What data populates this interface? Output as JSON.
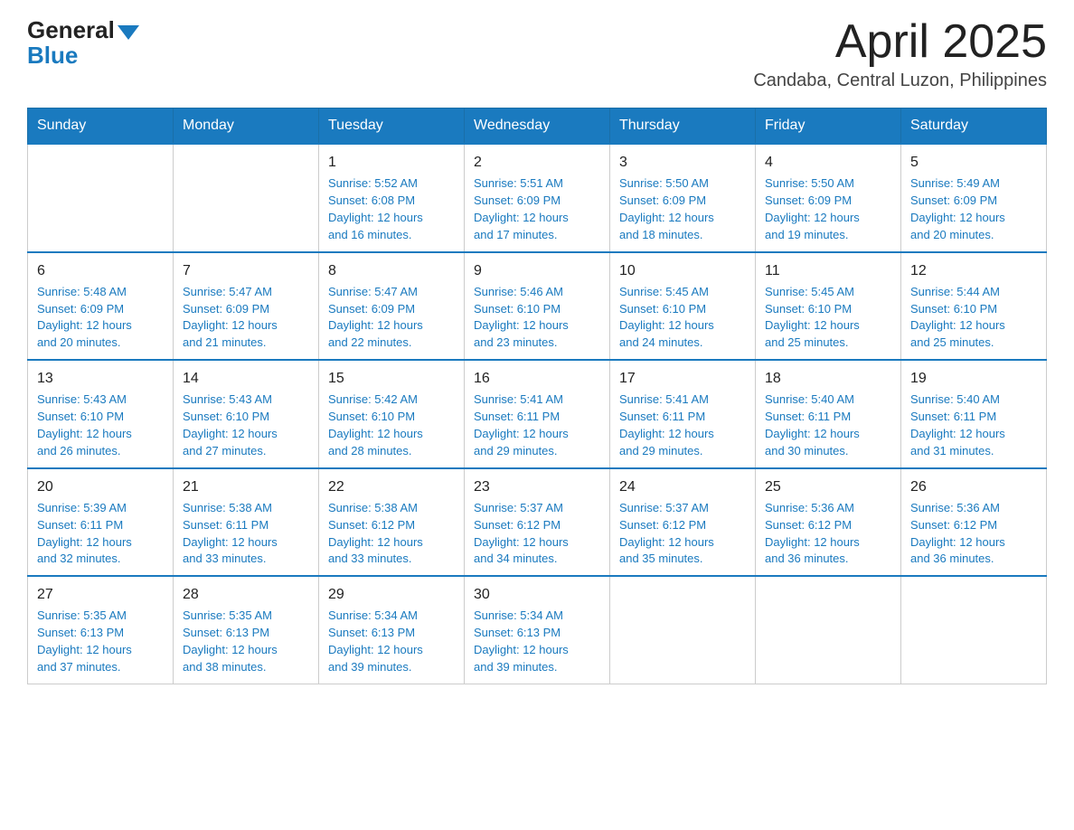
{
  "logo": {
    "general": "General",
    "blue": "Blue"
  },
  "header": {
    "month": "April 2025",
    "location": "Candaba, Central Luzon, Philippines"
  },
  "days_of_week": [
    "Sunday",
    "Monday",
    "Tuesday",
    "Wednesday",
    "Thursday",
    "Friday",
    "Saturday"
  ],
  "weeks": [
    [
      {
        "day": "",
        "info": ""
      },
      {
        "day": "",
        "info": ""
      },
      {
        "day": "1",
        "info": "Sunrise: 5:52 AM\nSunset: 6:08 PM\nDaylight: 12 hours\nand 16 minutes."
      },
      {
        "day": "2",
        "info": "Sunrise: 5:51 AM\nSunset: 6:09 PM\nDaylight: 12 hours\nand 17 minutes."
      },
      {
        "day": "3",
        "info": "Sunrise: 5:50 AM\nSunset: 6:09 PM\nDaylight: 12 hours\nand 18 minutes."
      },
      {
        "day": "4",
        "info": "Sunrise: 5:50 AM\nSunset: 6:09 PM\nDaylight: 12 hours\nand 19 minutes."
      },
      {
        "day": "5",
        "info": "Sunrise: 5:49 AM\nSunset: 6:09 PM\nDaylight: 12 hours\nand 20 minutes."
      }
    ],
    [
      {
        "day": "6",
        "info": "Sunrise: 5:48 AM\nSunset: 6:09 PM\nDaylight: 12 hours\nand 20 minutes."
      },
      {
        "day": "7",
        "info": "Sunrise: 5:47 AM\nSunset: 6:09 PM\nDaylight: 12 hours\nand 21 minutes."
      },
      {
        "day": "8",
        "info": "Sunrise: 5:47 AM\nSunset: 6:09 PM\nDaylight: 12 hours\nand 22 minutes."
      },
      {
        "day": "9",
        "info": "Sunrise: 5:46 AM\nSunset: 6:10 PM\nDaylight: 12 hours\nand 23 minutes."
      },
      {
        "day": "10",
        "info": "Sunrise: 5:45 AM\nSunset: 6:10 PM\nDaylight: 12 hours\nand 24 minutes."
      },
      {
        "day": "11",
        "info": "Sunrise: 5:45 AM\nSunset: 6:10 PM\nDaylight: 12 hours\nand 25 minutes."
      },
      {
        "day": "12",
        "info": "Sunrise: 5:44 AM\nSunset: 6:10 PM\nDaylight: 12 hours\nand 25 minutes."
      }
    ],
    [
      {
        "day": "13",
        "info": "Sunrise: 5:43 AM\nSunset: 6:10 PM\nDaylight: 12 hours\nand 26 minutes."
      },
      {
        "day": "14",
        "info": "Sunrise: 5:43 AM\nSunset: 6:10 PM\nDaylight: 12 hours\nand 27 minutes."
      },
      {
        "day": "15",
        "info": "Sunrise: 5:42 AM\nSunset: 6:10 PM\nDaylight: 12 hours\nand 28 minutes."
      },
      {
        "day": "16",
        "info": "Sunrise: 5:41 AM\nSunset: 6:11 PM\nDaylight: 12 hours\nand 29 minutes."
      },
      {
        "day": "17",
        "info": "Sunrise: 5:41 AM\nSunset: 6:11 PM\nDaylight: 12 hours\nand 29 minutes."
      },
      {
        "day": "18",
        "info": "Sunrise: 5:40 AM\nSunset: 6:11 PM\nDaylight: 12 hours\nand 30 minutes."
      },
      {
        "day": "19",
        "info": "Sunrise: 5:40 AM\nSunset: 6:11 PM\nDaylight: 12 hours\nand 31 minutes."
      }
    ],
    [
      {
        "day": "20",
        "info": "Sunrise: 5:39 AM\nSunset: 6:11 PM\nDaylight: 12 hours\nand 32 minutes."
      },
      {
        "day": "21",
        "info": "Sunrise: 5:38 AM\nSunset: 6:11 PM\nDaylight: 12 hours\nand 33 minutes."
      },
      {
        "day": "22",
        "info": "Sunrise: 5:38 AM\nSunset: 6:12 PM\nDaylight: 12 hours\nand 33 minutes."
      },
      {
        "day": "23",
        "info": "Sunrise: 5:37 AM\nSunset: 6:12 PM\nDaylight: 12 hours\nand 34 minutes."
      },
      {
        "day": "24",
        "info": "Sunrise: 5:37 AM\nSunset: 6:12 PM\nDaylight: 12 hours\nand 35 minutes."
      },
      {
        "day": "25",
        "info": "Sunrise: 5:36 AM\nSunset: 6:12 PM\nDaylight: 12 hours\nand 36 minutes."
      },
      {
        "day": "26",
        "info": "Sunrise: 5:36 AM\nSunset: 6:12 PM\nDaylight: 12 hours\nand 36 minutes."
      }
    ],
    [
      {
        "day": "27",
        "info": "Sunrise: 5:35 AM\nSunset: 6:13 PM\nDaylight: 12 hours\nand 37 minutes."
      },
      {
        "day": "28",
        "info": "Sunrise: 5:35 AM\nSunset: 6:13 PM\nDaylight: 12 hours\nand 38 minutes."
      },
      {
        "day": "29",
        "info": "Sunrise: 5:34 AM\nSunset: 6:13 PM\nDaylight: 12 hours\nand 39 minutes."
      },
      {
        "day": "30",
        "info": "Sunrise: 5:34 AM\nSunset: 6:13 PM\nDaylight: 12 hours\nand 39 minutes."
      },
      {
        "day": "",
        "info": ""
      },
      {
        "day": "",
        "info": ""
      },
      {
        "day": "",
        "info": ""
      }
    ]
  ]
}
